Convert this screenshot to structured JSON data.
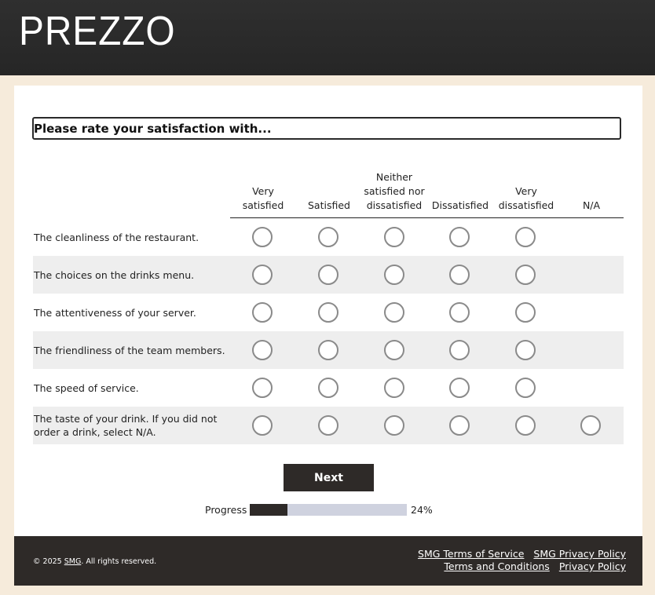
{
  "brand": {
    "logo_text": "PREZZO"
  },
  "question": {
    "title": "Please rate your satisfaction with..."
  },
  "columns": [
    "Very satisfied",
    "Satisfied",
    "Neither satisfied nor dissatisfied",
    "Dissatisfied",
    "Very dissatisfied",
    "N/A"
  ],
  "rows": [
    {
      "label": "The cleanliness of the restaurant.",
      "has_na": false
    },
    {
      "label": "The choices on the drinks menu.",
      "has_na": false
    },
    {
      "label": "The attentiveness of your server.",
      "has_na": false
    },
    {
      "label": "The friendliness of the team members.",
      "has_na": false
    },
    {
      "label": "The speed of service.",
      "has_na": false
    },
    {
      "label": "The taste of your drink. If you did not order a drink, select N/A.",
      "has_na": true
    }
  ],
  "actions": {
    "next_label": "Next"
  },
  "progress": {
    "label": "Progress",
    "percent_text": "24%",
    "value": 0.24
  },
  "footer": {
    "copyright_prefix": "© 2025 ",
    "copyright_link": "SMG",
    "copyright_suffix": ". All rights reserved.",
    "links_row1": [
      "SMG Terms of Service",
      "SMG Privacy Policy"
    ],
    "links_row2": [
      "Terms and Conditions",
      "Privacy Policy"
    ]
  },
  "colors": {
    "header_bg": "#2b2b2b",
    "page_bg": "#f6ebdb",
    "button_bg": "#2e2a28",
    "progress_track": "#cfd2df",
    "row_alt": "#eeeeee"
  }
}
